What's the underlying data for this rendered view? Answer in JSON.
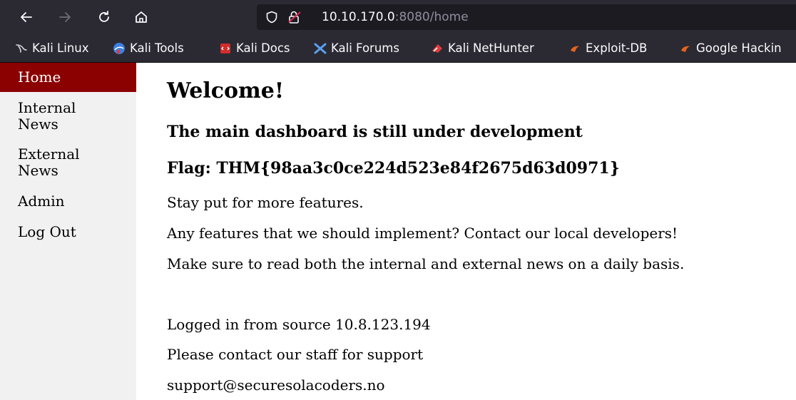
{
  "browser": {
    "url_host": "10.10.170.0",
    "url_rest": ":8080/home",
    "bookmarks": [
      {
        "label": "Kali Linux",
        "icon": "kali-dragon-icon"
      },
      {
        "label": "Kali Tools",
        "icon": "kali-tools-icon"
      },
      {
        "label": "Kali Docs",
        "icon": "kali-docs-icon"
      },
      {
        "label": "Kali Forums",
        "icon": "kali-forums-icon"
      },
      {
        "label": "Kali NetHunter",
        "icon": "kali-nethunter-icon"
      },
      {
        "label": "Exploit-DB",
        "icon": "exploit-db-icon"
      },
      {
        "label": "Google Hackin",
        "icon": "google-hacking-icon"
      }
    ]
  },
  "sidebar": {
    "items": [
      {
        "line1": "Home",
        "line2": "",
        "active": true
      },
      {
        "line1": "Internal",
        "line2": "News",
        "active": false
      },
      {
        "line1": "External",
        "line2": "News",
        "active": false
      },
      {
        "line1": "Admin",
        "line2": "",
        "active": false
      },
      {
        "line1": "Log Out",
        "line2": "",
        "active": false
      }
    ],
    "active_color": "#8b0000"
  },
  "main": {
    "title": "Welcome!",
    "subtitle": "The main dashboard is still under development",
    "flag": "Flag: THM{98aa3c0ce224d523e84f2675d63d0971}",
    "line1": "Stay put for more features.",
    "line2": "Any features that we should implement? Contact our local developers!",
    "line3": "Make sure to read both the internal and external news on a daily basis.",
    "logged_in": "Logged in from source 10.8.123.194",
    "contact": "Please contact our staff for support",
    "email": "support@securesolacoders.no"
  }
}
